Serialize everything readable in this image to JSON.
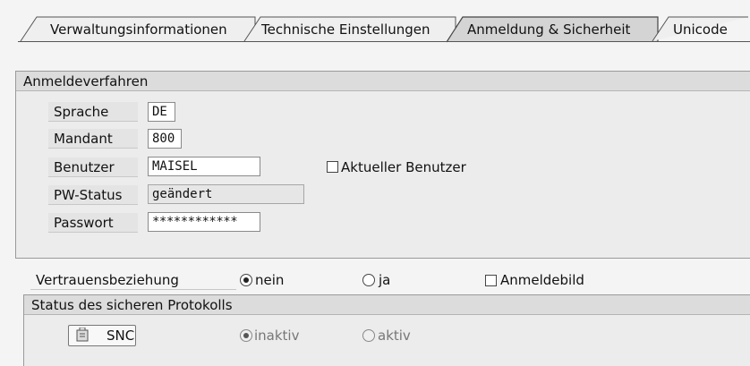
{
  "tabs": [
    {
      "label": "Verwaltungsinformationen"
    },
    {
      "label": "Technische Einstellungen"
    },
    {
      "label": "Anmeldung & Sicherheit"
    },
    {
      "label": "Unicode"
    }
  ],
  "active_tab": "Anmeldung & Sicherheit",
  "anmeldeverfahren": {
    "title": "Anmeldeverfahren",
    "fields": {
      "sprache": {
        "label": "Sprache",
        "value": "DE"
      },
      "mandant": {
        "label": "Mandant",
        "value": "800"
      },
      "benutzer": {
        "label": "Benutzer",
        "value": "MAISEL"
      },
      "pw_status": {
        "label": "PW-Status",
        "value": "geändert"
      },
      "passwort": {
        "label": "Passwort",
        "value": "************"
      }
    },
    "aktueller_benutzer": {
      "label": "Aktueller Benutzer",
      "checked": false
    }
  },
  "vertrauensbeziehung": {
    "label": "Vertrauensbeziehung",
    "option_nein": "nein",
    "option_ja": "ja",
    "selected": "nein",
    "anmeldebild": {
      "label": "Anmeldebild",
      "checked": false
    }
  },
  "snc": {
    "title": "Status des sicheren Protokolls",
    "button_label": "SNC",
    "option_inaktiv": "inaktiv",
    "option_aktiv": "aktiv",
    "selected": "inaktiv"
  }
}
